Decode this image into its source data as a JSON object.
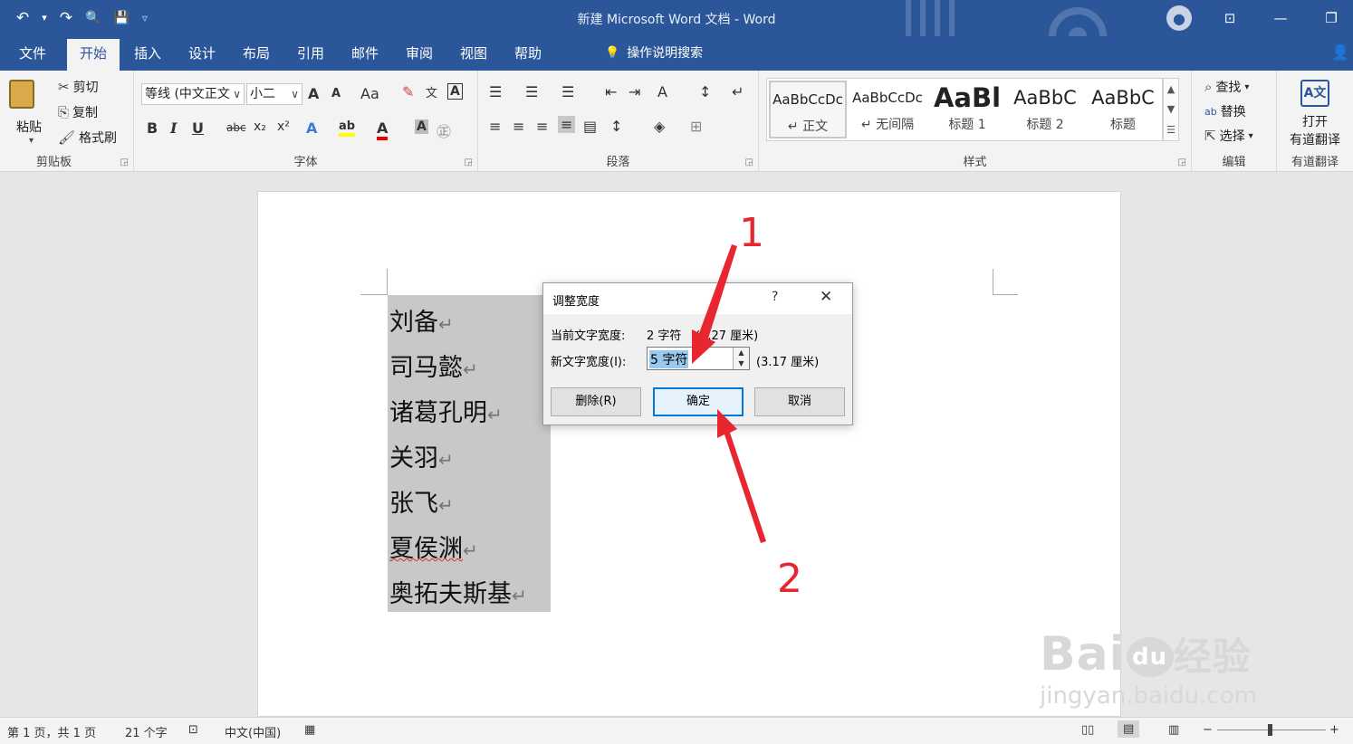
{
  "window": {
    "title": "新建 Microsoft Word 文档  -  Word"
  },
  "qat": {
    "undo_icon": "↶",
    "dropdown_icon": "▾",
    "redo_icon": "↷",
    "print_preview_icon": "🔍",
    "save_icon": "💾",
    "customize_icon": "▿"
  },
  "tabs": [
    "文件",
    "开始",
    "插入",
    "设计",
    "布局",
    "引用",
    "邮件",
    "审阅",
    "视图",
    "帮助"
  ],
  "active_tab": "开始",
  "tellme": {
    "icon": "💡",
    "label": "操作说明搜索"
  },
  "share_icon": "👤",
  "clipboard": {
    "paste": "粘贴",
    "cut": "剪切",
    "copy": "复制",
    "format_painter": "格式刷",
    "group_label": "剪贴板"
  },
  "font": {
    "font_name": "等线 (中文正文",
    "font_size": "小二",
    "grow": "A",
    "shrink": "A",
    "change_case": "Aa",
    "bold": "B",
    "italic": "I",
    "underline": "U",
    "strike": "abc",
    "subscript": "x₂",
    "superscript": "x²",
    "group_label": "字体"
  },
  "paragraph": {
    "group_label": "段落"
  },
  "styles": {
    "items": [
      {
        "preview": "AaBbCcDc",
        "name": "↵ 正文"
      },
      {
        "preview": "AaBbCcDc",
        "name": "↵ 无间隔"
      },
      {
        "preview": "AaBl",
        "name": "标题 1"
      },
      {
        "preview": "AaBbC",
        "name": "标题 2"
      },
      {
        "preview": "AaBbC",
        "name": "标题"
      }
    ],
    "group_label": "样式"
  },
  "editing": {
    "find": "查找",
    "replace": "替换",
    "select": "选择",
    "group_label": "编辑"
  },
  "youdao": {
    "open": "打开",
    "translate": "有道翻译",
    "group_label": "有道翻译"
  },
  "document": {
    "lines": [
      "刘备",
      "司马懿",
      "诸葛孔明",
      "关羽",
      "张飞",
      "夏侯渊",
      "奥拓夫斯基"
    ],
    "paragraph_mark": "↵"
  },
  "dialog": {
    "title": "调整宽度",
    "help": "?",
    "close": "✕",
    "current_label": "当前文字宽度:",
    "current_value": "2 字符",
    "current_cm": "(1.27 厘米)",
    "new_label": "新文字宽度(I):",
    "new_value": "5 字符",
    "new_cm": "(3.17 厘米)",
    "delete_button": "删除(R)",
    "ok_button": "确定",
    "cancel_button": "取消"
  },
  "annotations": {
    "one": "1",
    "two": "2"
  },
  "status": {
    "page": "第 1 页，共 1 页",
    "words": "21 个字",
    "language": "中文(中国)",
    "zoom_minus": "−",
    "zoom_plus": "+"
  },
  "watermark": {
    "brand": "Bai",
    "brand2": "du",
    "suffix": "经验",
    "url": "jingyan.baidu.com"
  },
  "colors": {
    "word_blue": "#2b579a",
    "annotation_red": "#e8262f",
    "selection": "#c8c8c8",
    "dialog_focus": "#0078d7"
  }
}
